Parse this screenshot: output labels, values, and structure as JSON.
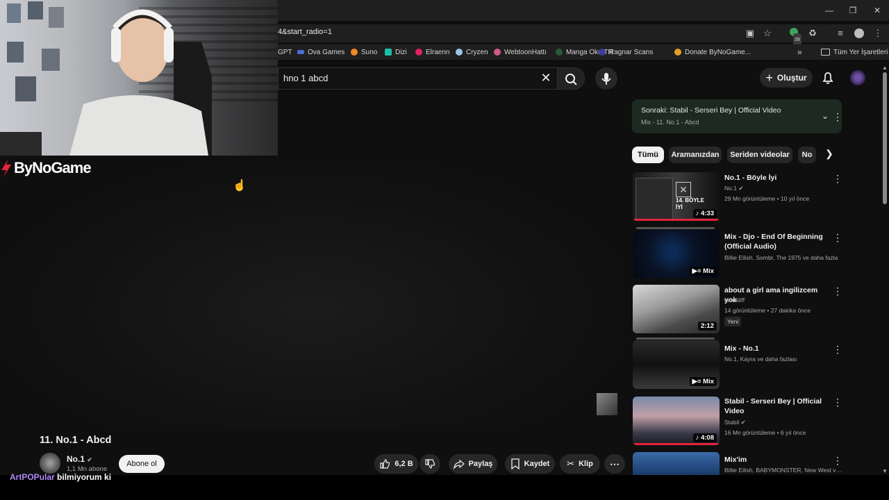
{
  "browser": {
    "url": "4&start_radio=1",
    "bookmarks": [
      "GPT",
      "Ova Games",
      "Suno",
      "Dizi",
      "Elraenn",
      "Cryzen",
      "WebtoonHattı",
      "Manga Oku TR",
      "Ragnar Scans",
      "Donate ByNoGame..."
    ],
    "all_bookmarks": "Tüm Yer İşaretleri",
    "extension_badge": "39"
  },
  "header": {
    "search_query": "hno 1 abcd",
    "create_label": "Oluştur"
  },
  "overlay": {
    "brand": "ByNoGame",
    "ticker_user": "ArtPOPular",
    "ticker_message": "bilmiyorum ki"
  },
  "video": {
    "title": "11. No.1 - Abcd",
    "channel": "No.1",
    "subscribers": "1,1 Mn abone",
    "subscribe_label": "Abone ol",
    "likes": "6,2 B",
    "share_label": "Paylaş",
    "save_label": "Kaydet",
    "clip_label": "Klip"
  },
  "up_next": {
    "title": "Sonraki: Stabil - Serseri Bey | Official Video",
    "subtitle": "Mix - 11. No.1 - Abcd"
  },
  "chips": [
    "Tümü",
    "Aramanızdan",
    "Seriden videolar",
    "No"
  ],
  "recommendations": [
    {
      "title": "No.1 - Böyle İyi",
      "channel": "No.1",
      "meta": "29 Mn görüntüleme • 10 yıl önce",
      "duration": "4:33",
      "thumb_text": "14. BÖYLE İYİ"
    },
    {
      "title": "Mix - Djo - End Of Beginning (Official Audio)",
      "channel": "Billie Eilish, Sombr, The 1975 ve daha fazla",
      "duration": "Mix"
    },
    {
      "title": "about a girl ama ingilizcem yok",
      "channel": "cumaliff",
      "meta": "14 görüntüleme • 27 dakika önce",
      "badge": "Yeni",
      "duration": "2:12"
    },
    {
      "title": "Mix - No.1",
      "channel": "No.1, Kayra ve daha fazlası",
      "duration": "Mix"
    },
    {
      "title": "Stabil - Serseri Bey | Official Video",
      "channel": "Stabil",
      "meta": "16 Mn görüntüleme • 6 yıl önce",
      "duration": "4:08"
    },
    {
      "title": "Mix'im",
      "channel": "Billie Eilish, BABYMONSTER, New West ve daha fazlası"
    }
  ],
  "colors": {
    "accent_red": "#e5243b",
    "up_next_bg": "#1c2a22",
    "page_bg": "#0f0f0f"
  }
}
